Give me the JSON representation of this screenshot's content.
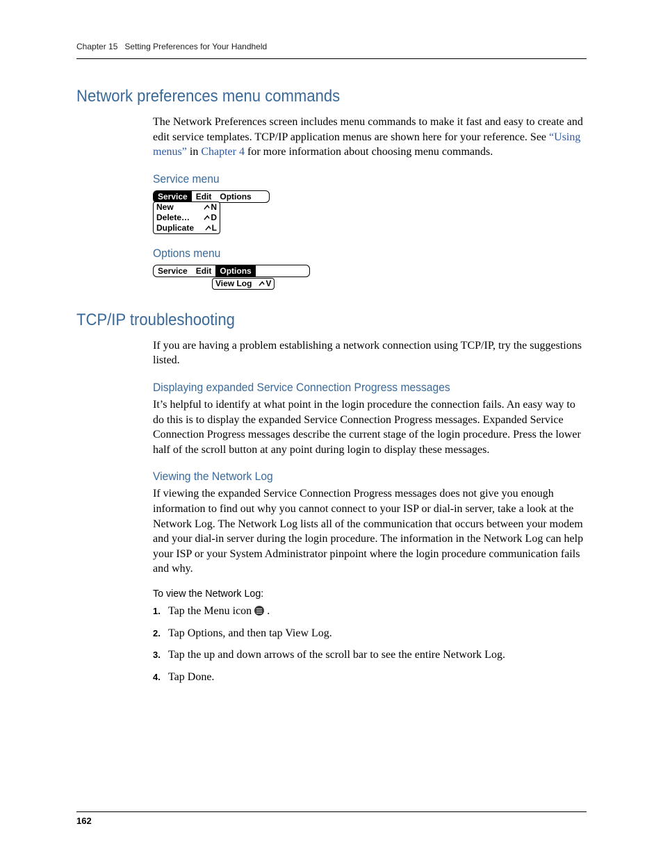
{
  "running_head": {
    "chapter": "Chapter 15",
    "title": "Setting Preferences for Your Handheld"
  },
  "section1": {
    "title": "Network preferences menu commands",
    "para_pre": "The Network Preferences screen includes menu commands to make it fast and easy to create and edit service templates. TCP/IP application menus are shown here for your reference. See ",
    "link1": "“Using menus”",
    "mid": " in ",
    "link2": "Chapter 4",
    "para_post": " for more information about choosing menu commands.",
    "service_menu": {
      "title": "Service menu",
      "bar": [
        "Service",
        "Edit",
        "Options"
      ],
      "items": [
        {
          "label": "New",
          "shortcut": "N"
        },
        {
          "label": "Delete…",
          "shortcut": "D"
        },
        {
          "label": "Duplicate",
          "shortcut": "L"
        }
      ]
    },
    "options_menu": {
      "title": "Options menu",
      "bar": [
        "Service",
        "Edit",
        "Options"
      ],
      "items": [
        {
          "label": "View Log",
          "shortcut": "V"
        }
      ]
    }
  },
  "section2": {
    "title": "TCP/IP troubleshooting",
    "intro": "If you are having a problem establishing a network connection using TCP/IP, try the suggestions listed.",
    "sub1": {
      "title": "Displaying expanded Service Connection Progress messages",
      "para": "It’s helpful to identify at what point in the login procedure the connection fails. An easy way to do this is to display the expanded Service Connection Progress messages. Expanded Service Connection Progress messages describe the current stage of the login procedure. Press the lower half of the scroll button at any point during login to display these messages."
    },
    "sub2": {
      "title": "Viewing the Network Log",
      "para": "If viewing the expanded Service Connection Progress messages does not give you enough information to find out why you cannot connect to your ISP or dial-in server, take a look at the Network Log. The Network Log lists all of the communication that occurs between your modem and your dial-in server during the login procedure. The information in the Network Log can help your ISP or your System Administrator pinpoint where the login procedure communication fails and why.",
      "howto_title": "To view the Network Log:",
      "steps": [
        "Tap the Menu icon ",
        "Tap Options, and then tap View Log.",
        "Tap the up and down arrows of the scroll bar to see the entire Network Log.",
        "Tap Done."
      ],
      "step_nums": [
        "1.",
        "2.",
        "3.",
        "4."
      ]
    }
  },
  "page_number": "162"
}
